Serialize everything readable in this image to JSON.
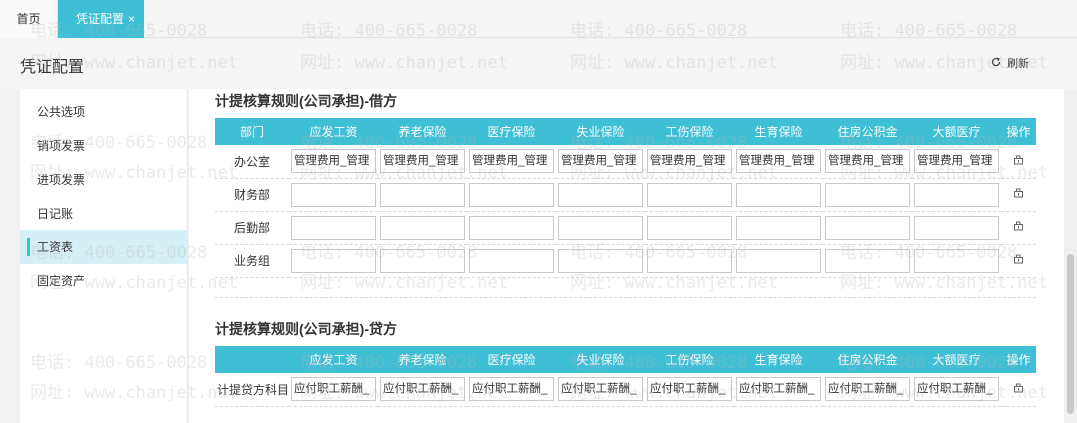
{
  "tabs": {
    "home": "首页",
    "active": "凭证配置",
    "close": "×"
  },
  "header": {
    "title": "凭证配置",
    "refresh": "刷新"
  },
  "sidebar": {
    "items": [
      {
        "label": "公共选项"
      },
      {
        "label": "销项发票"
      },
      {
        "label": "进项发票"
      },
      {
        "label": "日记账"
      },
      {
        "label": "工资表"
      },
      {
        "label": "固定资产"
      }
    ],
    "active_index": 4
  },
  "debit": {
    "title": "计提核算规则(公司承担)-借方",
    "columns": [
      "部门",
      "应发工资",
      "养老保险",
      "医疗保险",
      "失业保险",
      "工伤保险",
      "生育保险",
      "住房公积金",
      "大额医疗",
      "操作"
    ],
    "rows": [
      {
        "dept": "办公室",
        "values": [
          "管理费用_管理",
          "管理费用_管理",
          "管理费用_管理",
          "管理费用_管理",
          "管理费用_管理",
          "管理费用_管理",
          "管理费用_管理",
          "管理费用_管理"
        ]
      },
      {
        "dept": "财务部",
        "values": [
          "",
          "",
          "",
          "",
          "",
          "",
          "",
          ""
        ]
      },
      {
        "dept": "后勤部",
        "values": [
          "",
          "",
          "",
          "",
          "",
          "",
          "",
          ""
        ]
      },
      {
        "dept": "业务组",
        "values": [
          "",
          "",
          "",
          "",
          "",
          "",
          "",
          ""
        ]
      }
    ]
  },
  "credit": {
    "title": "计提核算规则(公司承担)-贷方",
    "columns": [
      "",
      "应发工资",
      "养老保险",
      "医疗保险",
      "失业保险",
      "工伤保险",
      "生育保险",
      "住房公积金",
      "大额医疗",
      "操作"
    ],
    "rows": [
      {
        "dept": "计提贷方科目",
        "values": [
          "应付职工薪酬_",
          "应付职工薪酬_",
          "应付职工薪酬_",
          "应付职工薪酬_",
          "应付职工薪酬_",
          "应付职工薪酬_",
          "应付职工薪酬_",
          "应付职工薪酬_"
        ]
      }
    ]
  },
  "watermark": {
    "phone": "电话: 400-665-0028",
    "site": "网址: www.chanjet.net"
  },
  "colors": {
    "accent": "#3fbfd6",
    "active_bg": "#d4f0f5"
  }
}
